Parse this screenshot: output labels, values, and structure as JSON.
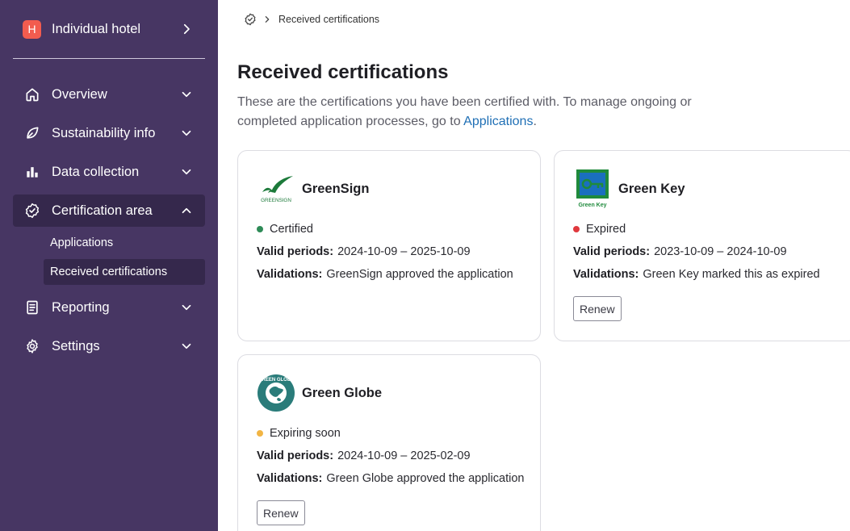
{
  "sidebar": {
    "hotel": {
      "badge": "H",
      "name": "Individual hotel"
    },
    "nav": [
      {
        "label": "Overview",
        "icon": "home-icon"
      },
      {
        "label": "Sustainability info",
        "icon": "leaf-icon"
      },
      {
        "label": "Data collection",
        "icon": "bar-chart-icon"
      },
      {
        "label": "Certification area",
        "icon": "certificate-badge-icon"
      },
      {
        "label": "Reporting",
        "icon": "report-icon"
      },
      {
        "label": "Settings",
        "icon": "gear-icon"
      }
    ],
    "cert_sub": [
      {
        "label": "Applications"
      },
      {
        "label": "Received certifications"
      }
    ]
  },
  "breadcrumb": {
    "current": "Received certifications"
  },
  "page": {
    "title": "Received certifications",
    "description": "These are the certifications you have been certified with. To manage ongoing or completed application processes, go to ",
    "link": "Applications",
    "link_suffix": "."
  },
  "labels": {
    "valid_periods": "Valid periods:",
    "validations": "Validations:",
    "renew": "Renew"
  },
  "certifications": [
    {
      "name": "GreenSign",
      "logo_text": "GREENSIGN",
      "status": "Certified",
      "status_color": "#2e8b57",
      "valid_period": "2024-10-09 – 2025-10-09",
      "validation": "GreenSign approved the application"
    },
    {
      "name": "Green Key",
      "logo_text": "Green Key",
      "status": "Expired",
      "status_color": "#e0393e",
      "valid_period": "2023-10-09 – 2024-10-09",
      "validation": "Green Key marked this as expired"
    },
    {
      "name": "Green Globe",
      "logo_text": "GREEN GLOBE",
      "status": "Expiring soon",
      "status_color": "#f2b544",
      "valid_period": "2024-10-09 – 2025-02-09",
      "validation": "Green Globe approved the application"
    }
  ],
  "colors": {
    "sidebar_bg": "#473663",
    "sidebar_active": "#35284c",
    "link": "#1f6fb5"
  }
}
